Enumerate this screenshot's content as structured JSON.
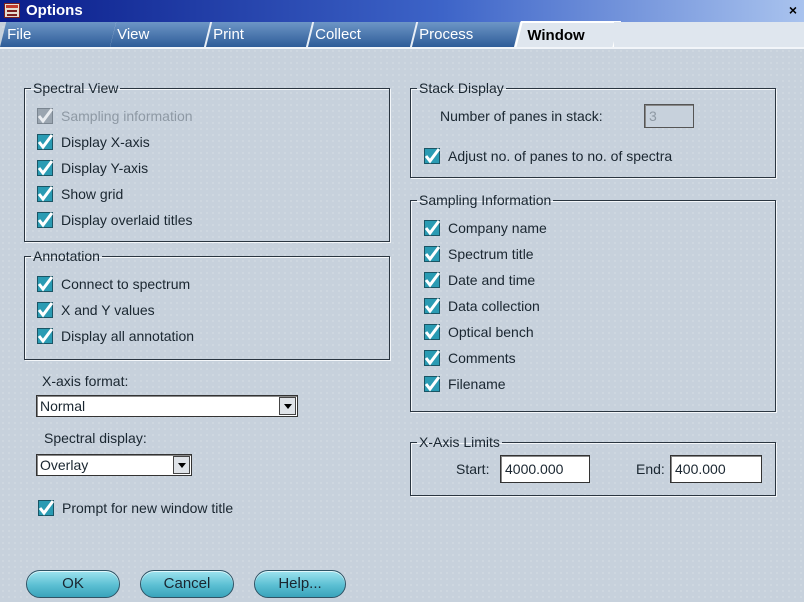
{
  "window": {
    "title": "Options",
    "close_glyph": "×",
    "icon": "app-icon"
  },
  "tabs": [
    {
      "label": "File",
      "active": false
    },
    {
      "label": "View",
      "active": false
    },
    {
      "label": "Print",
      "active": false
    },
    {
      "label": "Collect",
      "active": false
    },
    {
      "label": "Process",
      "active": false
    },
    {
      "label": "Window",
      "active": true
    }
  ],
  "spectral_view": {
    "legend": "Spectral View",
    "items": [
      {
        "label": "Sampling information",
        "checked": true,
        "enabled": false
      },
      {
        "label": "Display X-axis",
        "checked": true,
        "enabled": true
      },
      {
        "label": "Display Y-axis",
        "checked": true,
        "enabled": true
      },
      {
        "label": "Show grid",
        "checked": true,
        "enabled": true
      },
      {
        "label": "Display overlaid titles",
        "checked": true,
        "enabled": true
      }
    ]
  },
  "annotation": {
    "legend": "Annotation",
    "items": [
      {
        "label": "Connect to spectrum",
        "checked": true
      },
      {
        "label": "X and Y values",
        "checked": true
      },
      {
        "label": "Display all annotation",
        "checked": true
      }
    ]
  },
  "xaxis_format": {
    "label": "X-axis format:",
    "value": "Normal"
  },
  "spectral_display": {
    "label": "Spectral display:",
    "value": "Overlay"
  },
  "prompt_title": {
    "label": "Prompt for new window title",
    "checked": true
  },
  "stack_display": {
    "legend": "Stack Display",
    "panes_label": "Number of panes in stack:",
    "panes_value": "3",
    "adjust_label": "Adjust no. of panes to no. of spectra",
    "adjust_checked": true
  },
  "sampling_information": {
    "legend": "Sampling Information",
    "items": [
      {
        "label": "Company name",
        "checked": true
      },
      {
        "label": "Spectrum title",
        "checked": true
      },
      {
        "label": "Date and time",
        "checked": true
      },
      {
        "label": "Data collection",
        "checked": true
      },
      {
        "label": "Optical bench",
        "checked": true
      },
      {
        "label": "Comments",
        "checked": true
      },
      {
        "label": "Filename",
        "checked": true
      }
    ]
  },
  "xaxis_limits": {
    "legend": "X-Axis Limits",
    "start_label": "Start:",
    "start_value": "4000.000",
    "end_label": "End:",
    "end_value": "400.000"
  },
  "buttons": {
    "ok": "OK",
    "cancel": "Cancel",
    "help": "Help..."
  },
  "colors": {
    "titlebar": "#0a1d8a",
    "tab": "#2e5c98",
    "button": "#5bbfd3",
    "check": "#1f8a9e",
    "background": "#c7d1dc"
  }
}
